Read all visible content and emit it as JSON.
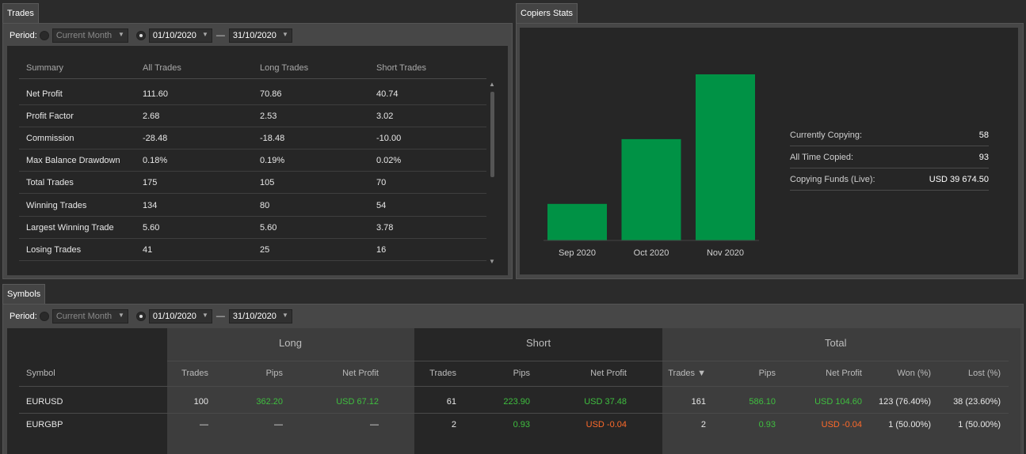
{
  "trades_tab": "Trades",
  "copiers_tab": "Copiers Stats",
  "symbols_tab": "Symbols",
  "period": {
    "label": "Period:",
    "preset": "Current Month",
    "from": "01/10/2020",
    "to": "31/10/2020",
    "separator": "—"
  },
  "trades": {
    "headers": [
      "Summary",
      "All Trades",
      "Long Trades",
      "Short Trades"
    ],
    "rows": [
      [
        "Net Profit",
        "111.60",
        "70.86",
        "40.74"
      ],
      [
        "Profit Factor",
        "2.68",
        "2.53",
        "3.02"
      ],
      [
        "Commission",
        "-28.48",
        "-18.48",
        "-10.00"
      ],
      [
        "Max Balance Drawdown",
        "0.18%",
        "0.19%",
        "0.02%"
      ],
      [
        "Total Trades",
        "175",
        "105",
        "70"
      ],
      [
        "Winning Trades",
        "134",
        "80",
        "54"
      ],
      [
        "Largest Winning Trade",
        "5.60",
        "5.60",
        "3.78"
      ],
      [
        "Losing Trades",
        "41",
        "25",
        "16"
      ]
    ]
  },
  "chart_data": {
    "type": "bar",
    "categories": [
      "Sep 2020",
      "Oct 2020",
      "Nov 2020"
    ],
    "values": [
      22,
      61,
      100
    ],
    "color": "#009245",
    "grid": false
  },
  "copier_stats": [
    {
      "label": "Currently Copying:",
      "value": "58"
    },
    {
      "label": "All Time Copied:",
      "value": "93"
    },
    {
      "label": "Copying Funds (Live):",
      "value": "USD 39 674.50"
    }
  ],
  "symbols": {
    "groups": [
      "Long",
      "Short",
      "Total"
    ],
    "symbol_header": "Symbol",
    "sub_headers": {
      "long": [
        "Trades",
        "Pips",
        "Net Profit"
      ],
      "short": [
        "Trades",
        "Pips",
        "Net Profit"
      ],
      "total": [
        "Trades ▼",
        "Pips",
        "Net Profit",
        "Won (%)",
        "Lost (%)"
      ]
    },
    "rows": [
      {
        "symbol": "EURUSD",
        "long": [
          "100",
          "362.20",
          "USD 67.12"
        ],
        "short": [
          "61",
          "223.90",
          "USD 37.48"
        ],
        "total": [
          "161",
          "586.10",
          "USD 104.60",
          "123 (76.40%)",
          "38 (23.60%)"
        ]
      },
      {
        "symbol": "EURGBP",
        "long": [
          "—",
          "—",
          "—"
        ],
        "short": [
          "2",
          "0.93",
          "USD -0.04"
        ],
        "total": [
          "2",
          "0.93",
          "USD -0.04",
          "1 (50.00%)",
          "1 (50.00%)"
        ]
      }
    ]
  }
}
